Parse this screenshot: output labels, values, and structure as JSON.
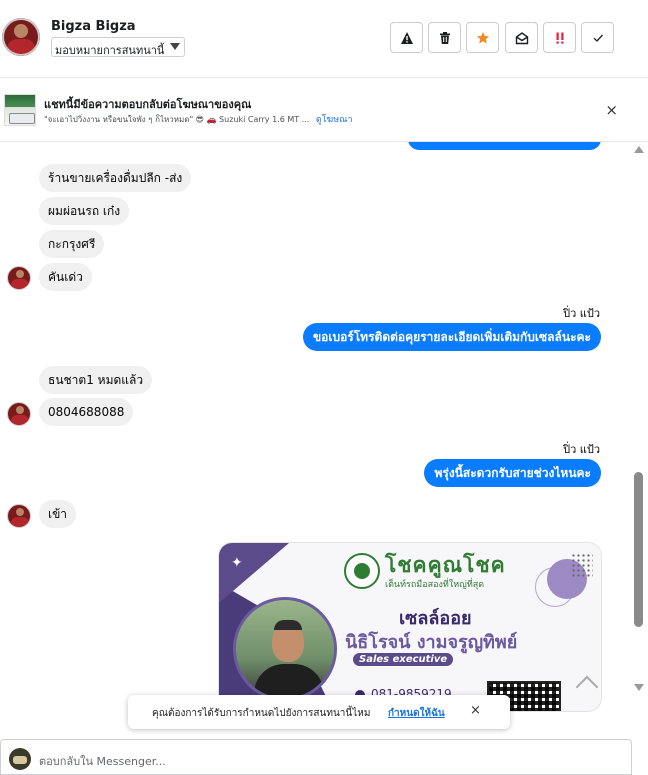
{
  "header": {
    "user_name": "Bigza Bigza",
    "assign_label": "มอบหมายการสนทนานี้",
    "tools": [
      {
        "name": "spam-button",
        "icon": "warning-icon"
      },
      {
        "name": "delete-button",
        "icon": "trash-icon"
      },
      {
        "name": "star-button",
        "icon": "star-icon"
      },
      {
        "name": "mark-unread-button",
        "icon": "envelope-open-icon"
      },
      {
        "name": "priority-button",
        "icon": "exclamation-icon"
      },
      {
        "name": "done-button",
        "icon": "check-icon"
      }
    ]
  },
  "ad_banner": {
    "title": "แชทนี้มีข้อความตอบกลับต่อโฆษณาของคุณ",
    "subtitle": "\"จะเอาไปวิ่งงาน หรือขนใจพัง ๆ ก็ไหวหมด\" 😎 🚗 Suzuki Carry 1.6 MT ...",
    "view_ad": "ดูโฆษณา",
    "close": "×"
  },
  "messages": {
    "in_1": "ร้านขายเครื่องดื่มปลีก -ส่ง",
    "in_2": "ผมผ่อนรถ เก๋ง",
    "in_3": "กะกรุงศรี",
    "in_4": "คันเด่ว",
    "sender_1": "ปิ่ว แป้ว",
    "out_1": "ขอเบอร์โทรติดต่อคุยรายละเอียดเพิ่มเติมกับเซลล์นะคะ",
    "in_5": "ธนชาต1 หมดแล้ว",
    "in_6": "0804688088",
    "sender_2": "ปิ่ว แป้ว",
    "out_2": "พรุ่งนี้สะดวกรับสายช่วงไหนคะ",
    "in_7": "เข้า"
  },
  "card": {
    "brand": "โชคคูณโชค",
    "tagline": "เต็นท์รถมือสองที่ใหญ่ที่สุด",
    "role": "เซลล์ออย",
    "person": "นิธิโรจน์  งามจรูญทิพย์",
    "title": "Sales executive",
    "phone": "081-9859219"
  },
  "toast": {
    "message": "คุณต้องการได้รับการกำหนดไปยังการสนทนานี้ไหม",
    "link": "กำหนดให้ฉัน",
    "close": "×"
  },
  "composer": {
    "placeholder": "ตอบกลับใน Messenger..."
  },
  "colors": {
    "outgoing_bubble": "#0a7cff",
    "incoming_bubble": "#f0f0f0",
    "link": "#1b74e4",
    "priority": "#e41e3f",
    "star": "#f28b1e"
  }
}
